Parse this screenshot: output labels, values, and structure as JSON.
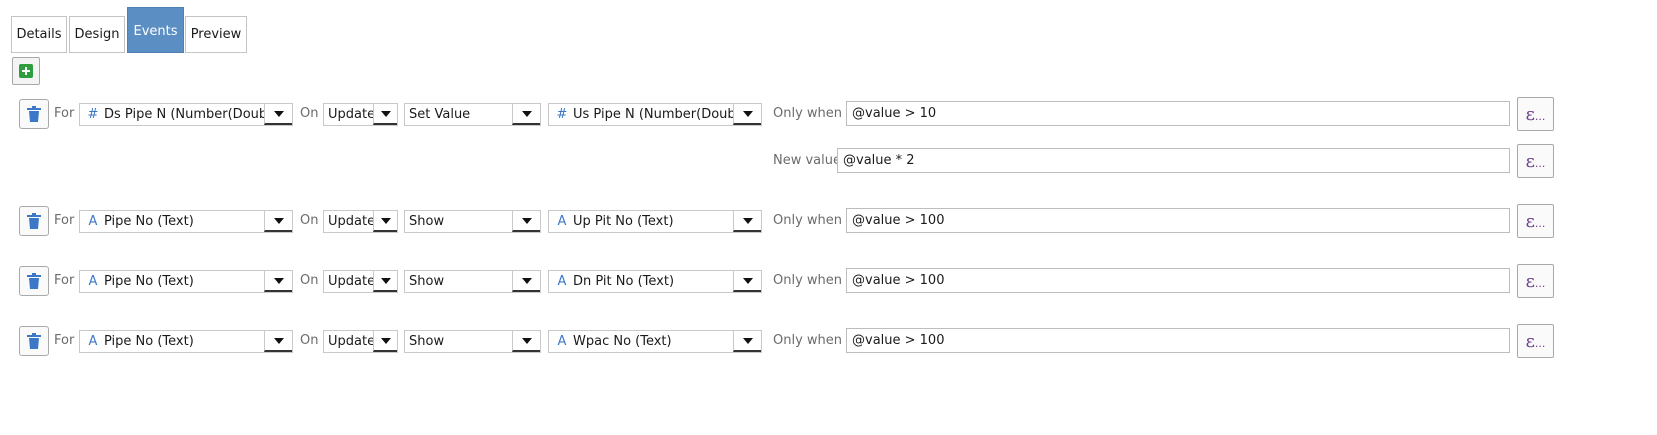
{
  "tabs": [
    {
      "label": "Details",
      "active": false
    },
    {
      "label": "Design",
      "active": false
    },
    {
      "label": "Events",
      "active": true
    },
    {
      "label": "Preview",
      "active": false
    }
  ],
  "icons": {
    "add": "add-icon",
    "delete": "trash-icon",
    "number_field": "#",
    "text_field": "A",
    "expression": "ε",
    "expression_suffix": "..."
  },
  "colors": {
    "active_tab": "#5b8fc4",
    "add_icon": "#2f9e3c",
    "trash_icon": "#3c78c8",
    "expression_icon": "#6a3d8e"
  },
  "labels": {
    "for": "For",
    "on": "On",
    "only_when": "Only when",
    "new_value": "New value"
  },
  "events": [
    {
      "for_field": "Ds Pipe N (Number(Double))",
      "on": "Update",
      "action": "Set Value",
      "target_field": "Us Pipe N (Number(Double))",
      "only_when": "@value > 10",
      "new_value": "@value * 2"
    },
    {
      "for_field": "Pipe No (Text)",
      "on": "Update",
      "action": "Show",
      "target_field": "Up Pit No (Text)",
      "only_when": "@value > 100"
    },
    {
      "for_field": "Pipe No (Text)",
      "on": "Update",
      "action": "Show",
      "target_field": "Dn Pit No (Text)",
      "only_when": "@value > 100"
    },
    {
      "for_field": "Pipe No (Text)",
      "on": "Update",
      "action": "Show",
      "target_field": "Wpac No (Text)",
      "only_when": "@value > 100"
    }
  ]
}
